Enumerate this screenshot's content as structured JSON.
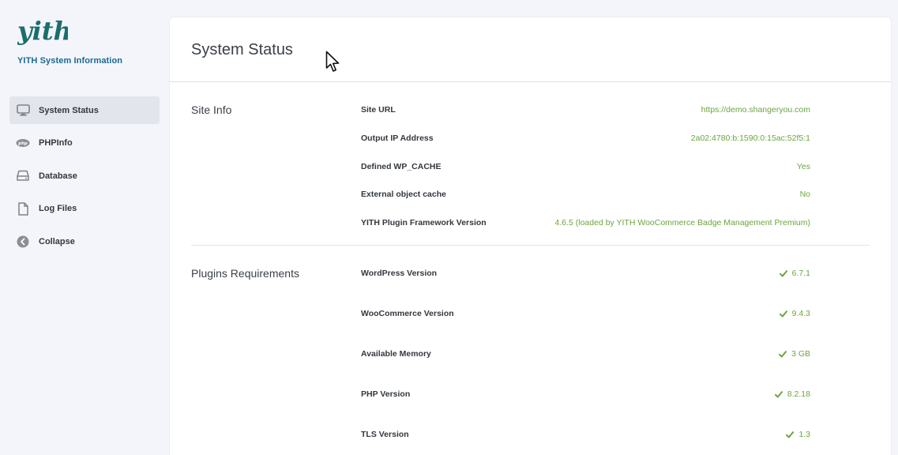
{
  "sidebar": {
    "brand_subtitle": "YITH System Information",
    "items": [
      {
        "label": "System Status",
        "icon": "monitor-icon",
        "active": true
      },
      {
        "label": "PHPInfo",
        "icon": "php-icon",
        "active": false
      },
      {
        "label": "Database",
        "icon": "database-icon",
        "active": false
      },
      {
        "label": "Log Files",
        "icon": "file-icon",
        "active": false
      },
      {
        "label": "Collapse",
        "icon": "collapse-arrow-icon",
        "active": false
      }
    ]
  },
  "main": {
    "title": "System Status",
    "site_info": {
      "title": "Site Info",
      "rows": [
        {
          "label": "Site URL",
          "value": "https://demo.shangeryou.com"
        },
        {
          "label": "Output IP Address",
          "value": "2a02:4780:b:1590:0:15ac:52f5:1"
        },
        {
          "label": "Defined WP_CACHE",
          "value": "Yes"
        },
        {
          "label": "External object cache",
          "value": "No"
        },
        {
          "label": "YITH Plugin Framework Version",
          "value": "4.6.5 (loaded by YITH WooCommerce Badge Management Premium)"
        }
      ]
    },
    "plugins_requirements": {
      "title": "Plugins Requirements",
      "rows": [
        {
          "label": "WordPress Version",
          "value": "6.7.1"
        },
        {
          "label": "WooCommerce Version",
          "value": "9.4.3"
        },
        {
          "label": "Available Memory",
          "value": "3 GB"
        },
        {
          "label": "PHP Version",
          "value": "8.2.18"
        },
        {
          "label": "TLS Version",
          "value": "1.3"
        }
      ]
    }
  },
  "colors": {
    "accent_green": "#6aa53f",
    "brand_blue": "#1a6a8f",
    "logo_teal": "#1b8a84"
  }
}
